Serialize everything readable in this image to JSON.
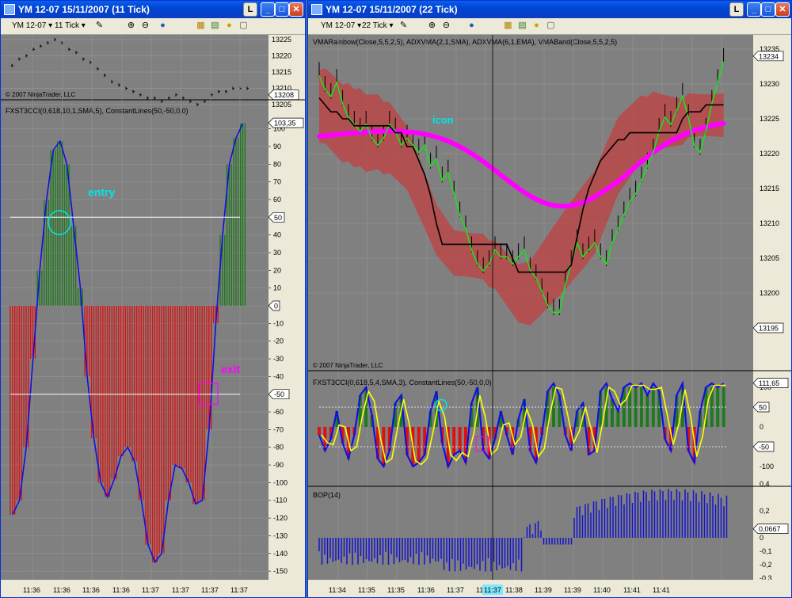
{
  "left_window": {
    "title": "YM 12-07  15/11/2007  (11 Tick)",
    "instrument": "YM 12-07",
    "period": "11 Tick",
    "price_axis": [
      "13225",
      "13220",
      "13215",
      "13210",
      "13205"
    ],
    "price_badge": "13208",
    "copyright": "© 2007 NinjaTrader, LLC",
    "indicator_label": "FXST3CCI(0,618,10,1,SMA,5), ConstantLines(50,-50,0,0)",
    "cci_badge": "103,35",
    "cci_axis": [
      "100",
      "90",
      "80",
      "70",
      "60",
      "50",
      "40",
      "30",
      "20",
      "10",
      "0",
      "-10",
      "-20",
      "-30",
      "-40",
      "-50",
      "-60",
      "-70",
      "-80",
      "-90",
      "-100",
      "-110",
      "-120",
      "-130",
      "-140",
      "-150"
    ],
    "line50_badge": "50",
    "line0_badge": "0",
    "linem50_badge": "-50",
    "annotation_entry": "entry",
    "annotation_exit": "exit",
    "time_labels": [
      "11:36",
      "11:36",
      "11:36",
      "11:36",
      "11:37",
      "11:37",
      "11:37",
      "11:37"
    ]
  },
  "right_window": {
    "title": "YM 12-07  15/11/2007  (22 Tick)",
    "instrument": "YM 12-07",
    "period": "22 Tick",
    "indicator_label": "VMARainbow(Close,5,5,2,5), ADXVMA(2,1,SMA), ADXVMA(6,1,EMA), VMABand(Close,5,5,2,5)",
    "price_axis": [
      "13235",
      "13230",
      "13225",
      "13220",
      "13215",
      "13210",
      "13205",
      "13200"
    ],
    "price_badge": "13234",
    "low_badge": "13195",
    "copyright": "© 2007 NinjaTrader, LLC",
    "annotation_icon": "icon",
    "cci_label": "FXST3CCI(0,618,5,4,SMA,3), ConstantLines(50,-50,0,0)",
    "cci_badge": "111,65",
    "cci_axis": [
      "100",
      "0",
      "-100"
    ],
    "cci_50_badge": "50",
    "cci_m50_badge": "-50",
    "bop_label": "BOP(14)",
    "bop_axis": [
      "0,4",
      "0,2",
      "0",
      "-0,1",
      "-0,2",
      "-0,3"
    ],
    "bop_badge": "0,0667",
    "time_labels": [
      "11:34",
      "11:35",
      "11:35",
      "11:36",
      "11:37",
      "11:38",
      "11:38",
      "11:39",
      "11:39",
      "11:40",
      "11:41",
      "11:41"
    ],
    "cursor_time": "11:37"
  },
  "colors": {
    "green_hist": "#1e7a1e",
    "red_hist": "#dd1111",
    "cci_line": "#1010e0",
    "magenta": "#ff00ff",
    "cyan": "#00e6e6",
    "band": "#c04040"
  }
}
